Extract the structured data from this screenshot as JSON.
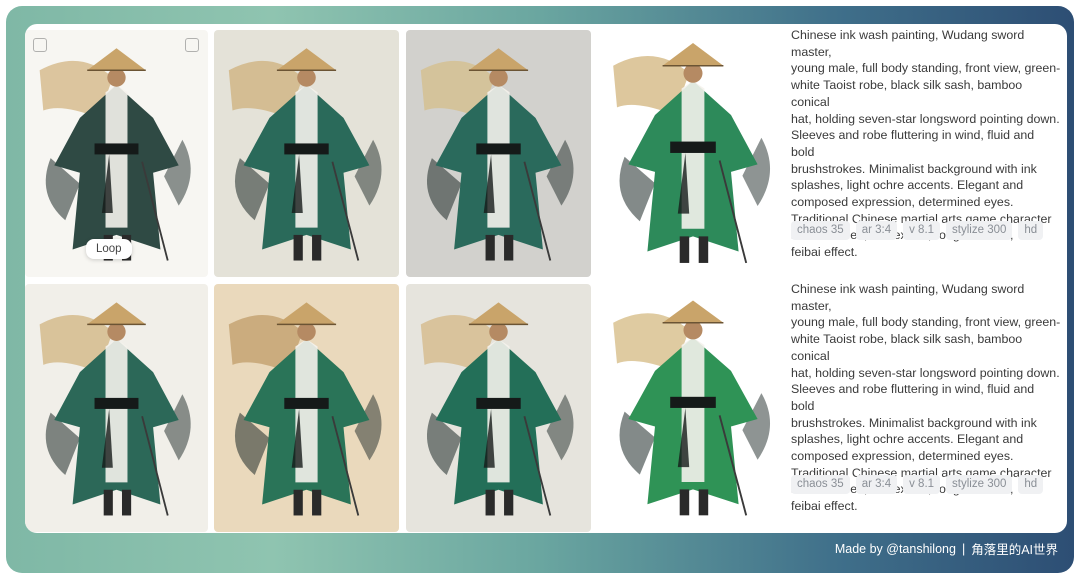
{
  "footer": {
    "credit": "Made by @tanshilong",
    "separator": "|",
    "brand": "角落里的AI世界"
  },
  "overlay": {
    "loop_label": "Loop"
  },
  "rows": [
    {
      "prompt_lines": [
        "Chinese ink wash painting, Wudang sword master,",
        "young male, full body standing, front view, green-",
        "white Taoist robe, black silk sash, bamboo conical",
        "hat, holding seven-star longsword pointing down.",
        "Sleeves and robe fluttering in wind, fluid and bold",
        "brushstrokes. Minimalist background with ink",
        "splashes, light ochre accents. Elegant and",
        "composed expression, determined eyes.",
        "Traditional Chinese martial arts game character",
        "select screen, ink texture, rough strokes,",
        "feibai effect."
      ],
      "params": [
        "chaos 35",
        "ar 3:4",
        "v 8.1",
        "stylize 300",
        "hd"
      ]
    },
    {
      "prompt_lines": [
        "Chinese ink wash painting, Wudang sword master,",
        "young male, full body standing, front view, green-",
        "white Taoist robe, black silk sash, bamboo conical",
        "hat, holding seven-star longsword pointing down.",
        "Sleeves and robe fluttering in wind, fluid and bold",
        "brushstrokes. Minimalist background with ink",
        "splashes, light ochre accents. Elegant and",
        "composed expression, determined eyes.",
        "Traditional Chinese martial arts game character",
        "select screen, ink texture, rough strokes,",
        "feibai effect."
      ],
      "params": [
        "chaos 35",
        "ar 3:4",
        "v 8.1",
        "stylize 300",
        "hd"
      ]
    }
  ],
  "images": [
    {
      "alt": "ink-swordsman-1",
      "bg": "#f7f6f2",
      "robe": "#2f4a44",
      "accent": "#c9a565"
    },
    {
      "alt": "ink-swordsman-2",
      "bg": "#e4e2d8",
      "robe": "#2a6a5a",
      "accent": "#c9a565"
    },
    {
      "alt": "ink-swordsman-3",
      "bg": "#d2d1cd",
      "robe": "#2a6a5c",
      "accent": "#d6b97a"
    },
    {
      "alt": "ink-swordsman-4",
      "bg": "#ffffff",
      "robe": "#2d8a5a",
      "accent": "#c6a15c"
    },
    {
      "alt": "ink-swordsman-5",
      "bg": "#f1efe9",
      "robe": "#2c6858",
      "accent": "#c9a565"
    },
    {
      "alt": "ink-swordsman-6",
      "bg": "#ead9bc",
      "robe": "#2a7458",
      "accent": "#b58d55"
    },
    {
      "alt": "ink-swordsman-7",
      "bg": "#e6e4dd",
      "robe": "#236f58",
      "accent": "#d0ae72"
    },
    {
      "alt": "ink-swordsman-8",
      "bg": "#ffffff",
      "robe": "#2f9356",
      "accent": "#c9a862"
    }
  ]
}
